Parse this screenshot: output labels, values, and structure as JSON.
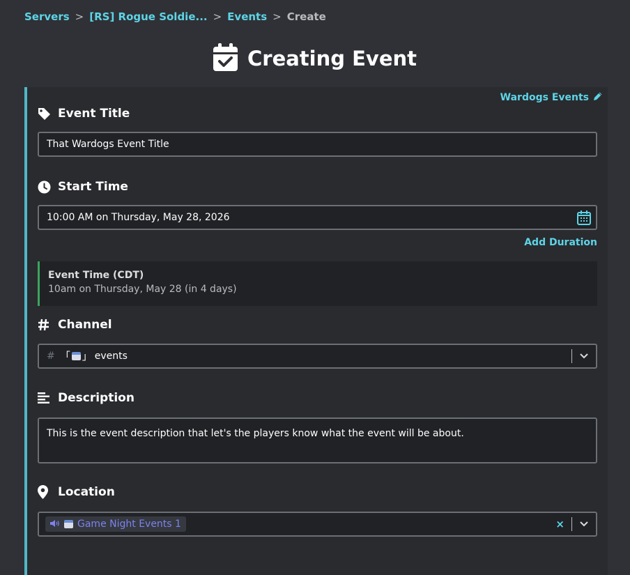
{
  "breadcrumb": {
    "servers": "Servers",
    "sep": ">",
    "server": "[RS] Rogue Soldie...",
    "events": "Events",
    "current": "Create"
  },
  "title": "Creating Event",
  "group_link": "Wardogs Events",
  "event_title": {
    "label": "Event Title",
    "value": "That Wardogs Event Title"
  },
  "start_time": {
    "label": "Start Time",
    "value": "10:00 AM on Thursday, May 28, 2026",
    "add_duration": "Add Duration"
  },
  "event_time": {
    "zone": "Event Time (CDT)",
    "when": "10am on Thursday, May 28 (in 4 days)"
  },
  "channel": {
    "label": "Channel",
    "hash": "#",
    "bracket_open": "「",
    "bracket_close": "」",
    "name": "events"
  },
  "description": {
    "label": "Description",
    "value": "This is the event description that let's the players know what the event will be about."
  },
  "location": {
    "label": "Location",
    "chip": "Game Night Events 1",
    "clear": "×"
  },
  "colors": {
    "background": "#2f3136",
    "panel": "#292b2f",
    "accent": "#5ed4e6",
    "panel_border": "#4fb8c8",
    "event_time_border": "#3ba55d",
    "chip_text": "#7c82f0"
  },
  "icons": [
    "calendar-check-icon",
    "pencil-icon",
    "tag-icon",
    "clock-icon",
    "calendar-icon",
    "hash-icon",
    "align-left-icon",
    "map-pin-icon",
    "speaker-icon",
    "chevron-down-icon"
  ]
}
